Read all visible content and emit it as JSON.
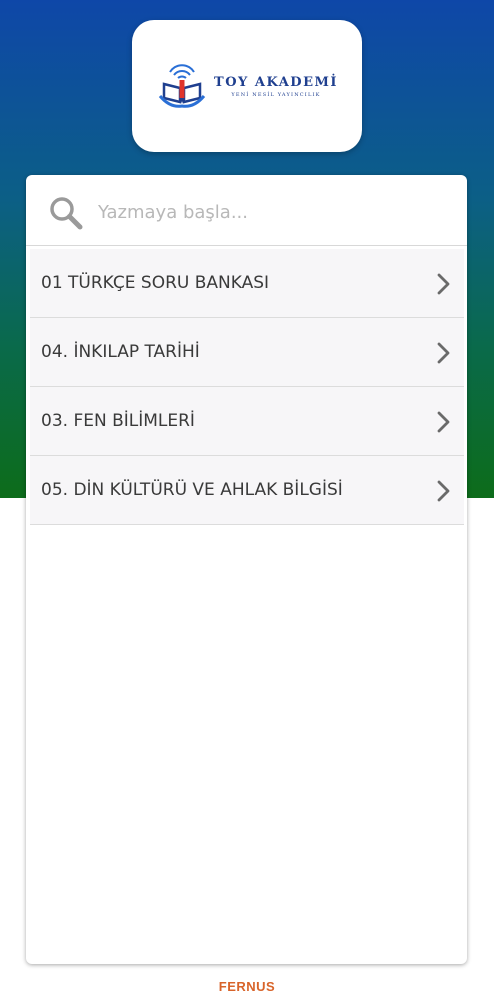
{
  "logo": {
    "title": "TOY AKADEMİ",
    "subtitle": "YENİ NESİL YAYINCILIK"
  },
  "search": {
    "placeholder": "Yazmaya başla...",
    "value": "",
    "icon": "search-icon"
  },
  "books": [
    {
      "label": "01 TÜRKÇE SORU BANKASI"
    },
    {
      "label": "04. İNKILAP TARİHİ"
    },
    {
      "label": "03. FEN BİLİMLERİ"
    },
    {
      "label": "05. DİN KÜLTÜRÜ VE AHLAK BİLGİSİ"
    }
  ],
  "footer": {
    "brand": "FERNUS"
  },
  "colors": {
    "header_gradient_top": "#0e47a8",
    "header_gradient_bottom": "#0d6c1a",
    "brand_orange": "#d8642a",
    "logo_blue": "#1f3f8f"
  }
}
